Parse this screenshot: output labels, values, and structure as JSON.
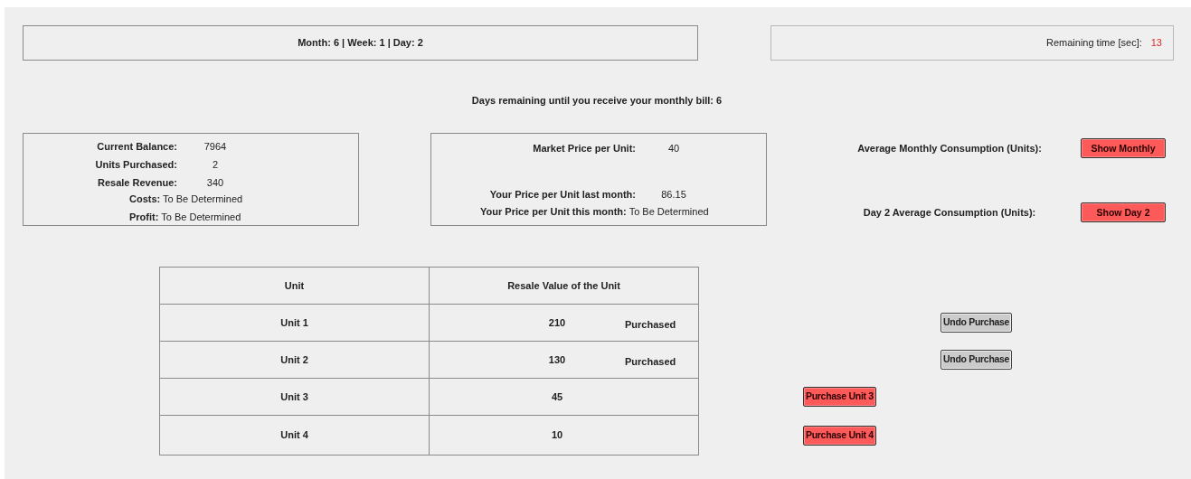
{
  "header": {
    "date": "Month: 6 | Week: 1 | Day: 2",
    "timer_label": "Remaining time [sec]:",
    "timer_value": "13"
  },
  "bill_notice": "Days remaining until you receive your monthly bill: 6",
  "balance": [
    {
      "label": "Current Balance:",
      "value": "7964",
      "kind": "pair"
    },
    {
      "label": "Units Purchased:",
      "value": "2",
      "kind": "pair"
    },
    {
      "label": "Resale Revenue:",
      "value": "340",
      "kind": "pair"
    },
    {
      "label": "Costs:",
      "value": "To Be Determined",
      "kind": "inline"
    },
    {
      "label": "Profit:",
      "value": "To Be Determined",
      "kind": "inline"
    }
  ],
  "market": [
    {
      "label": "Market Price per Unit:",
      "value": "40",
      "kind": "pair"
    },
    {
      "label": "Your Price per Unit last month:",
      "value": "86.15",
      "kind": "pair"
    },
    {
      "label": "Your Price per Unit this month:",
      "value": "To Be Determined",
      "kind": "inline"
    }
  ],
  "consumption": [
    {
      "label": "Average Monthly Consumption (Units):",
      "button": "Show Monthly"
    },
    {
      "label": "Day 2 Average Consumption (Units):",
      "button": "Show Day 2"
    }
  ],
  "table": {
    "columns": [
      "Unit",
      "Resale Value of the Unit"
    ],
    "rows": [
      {
        "unit": "Unit 1",
        "value": "210",
        "purchased": true,
        "status": "Purchased",
        "action": "Undo Purchase"
      },
      {
        "unit": "Unit 2",
        "value": "130",
        "purchased": true,
        "status": "Purchased",
        "action": "Undo Purchase"
      },
      {
        "unit": "Unit 3",
        "value": "45",
        "purchased": false,
        "action": "Purchase Unit 3"
      },
      {
        "unit": "Unit 4",
        "value": "10",
        "purchased": false,
        "action": "Purchase Unit 4"
      }
    ]
  }
}
